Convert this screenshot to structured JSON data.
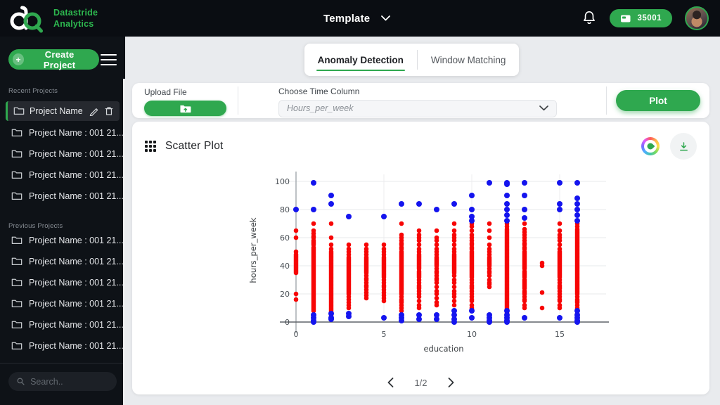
{
  "header": {
    "brand_line1": "Datastride",
    "brand_line2": "Analytics",
    "template_label": "Template",
    "credits": "35001"
  },
  "sidebar": {
    "create_project_label": "Create Project",
    "recent_label": "Recent Projects",
    "previous_label": "Previous Projects",
    "selected_project": "Project Name :...",
    "recent_projects": [
      "Project Name : 001 21...",
      "Project Name : 001 21...",
      "Project Name : 001 21...",
      "Project Name : 001 21..."
    ],
    "previous_projects": [
      "Project Name : 001 21...",
      "Project Name : 001 21...",
      "Project Name : 001 21...",
      "Project Name : 001 21...",
      "Project Name : 001 21...",
      "Project Name : 001 21...",
      "Project Name : 001 21..."
    ],
    "search_placeholder": "Search.."
  },
  "tabs": {
    "anomaly_label": "Anomaly Detection",
    "window_label": "Window Matching",
    "active": "Anomaly Detection"
  },
  "toolbar": {
    "upload_label": "Upload File",
    "time_column_label": "Choose Time Column",
    "time_column_value": "Hours_per_week",
    "plot_label": "Plot"
  },
  "card": {
    "title": "Scatter Plot"
  },
  "pagination": {
    "page": "1/2"
  },
  "colors": {
    "accent_green": "#2fa84f",
    "point_red": "#f70505",
    "point_blue": "#1414ee"
  },
  "chart_data": {
    "type": "scatter",
    "title": "Scatter Plot",
    "xlabel": "education",
    "ylabel": "hours_per_week",
    "xlim": [
      -0.9,
      17.6
    ],
    "ylim": [
      0,
      100
    ],
    "x_ticks": [
      0,
      5,
      10,
      15
    ],
    "y_ticks": [
      0,
      20,
      40,
      60,
      80,
      100
    ],
    "grid": true,
    "series": [
      {
        "name": "normal",
        "color": "#f70505",
        "marker_radius": 3.3,
        "columns": {
          "0": [
            65,
            60,
            50,
            48,
            47,
            46,
            45,
            44,
            43,
            42,
            41,
            40,
            39,
            38,
            37,
            36,
            35,
            20,
            16
          ],
          "1": [
            70,
            65,
            63,
            61,
            60,
            58,
            57,
            56,
            55,
            53,
            52,
            51,
            50,
            49,
            48,
            47,
            46,
            45,
            44,
            43,
            42,
            41,
            40,
            39,
            38,
            37,
            36,
            35,
            34,
            33,
            32,
            31,
            30,
            29,
            28,
            27,
            26,
            25,
            24,
            23,
            22,
            21,
            20,
            19,
            18,
            17,
            16,
            15,
            14,
            13,
            12,
            11,
            10,
            9,
            8
          ],
          "2": [
            70,
            60,
            55,
            52,
            50,
            49,
            48,
            47,
            46,
            45,
            44,
            43,
            42,
            41,
            40,
            39,
            38,
            37,
            36,
            35,
            34,
            33,
            32,
            31,
            30,
            29,
            28,
            27,
            26,
            25,
            24,
            23,
            22,
            21,
            20,
            19,
            18,
            17,
            16,
            15,
            14,
            13,
            12,
            11,
            10,
            9,
            8,
            7,
            6,
            5
          ],
          "3": [
            55,
            52,
            50,
            48,
            46,
            45,
            44,
            43,
            42,
            41,
            40,
            39,
            38,
            37,
            36,
            35,
            34,
            33,
            32,
            31,
            30,
            29,
            28,
            27,
            26,
            25,
            24,
            23,
            22,
            21,
            20,
            18,
            16,
            14,
            12,
            10
          ],
          "4": [
            55,
            52,
            50,
            48,
            46,
            45,
            44,
            43,
            42,
            41,
            40,
            39,
            38,
            37,
            36,
            35,
            33,
            31,
            30,
            28,
            26,
            25,
            23,
            21,
            19,
            17
          ],
          "5": [
            55,
            52,
            50,
            48,
            46,
            45,
            44,
            43,
            42,
            41,
            40,
            39,
            38,
            37,
            36,
            35,
            34,
            33,
            32,
            30,
            28,
            26,
            25,
            23,
            21,
            19,
            17,
            15
          ],
          "6": [
            70,
            62,
            60,
            58,
            56,
            55,
            53,
            52,
            50,
            49,
            48,
            47,
            46,
            45,
            44,
            43,
            42,
            41,
            40,
            39,
            38,
            37,
            36,
            35,
            34,
            33,
            32,
            31,
            30,
            29,
            28,
            27,
            26,
            25,
            24,
            23,
            22,
            21,
            20,
            18,
            16,
            15,
            14,
            12,
            10,
            8
          ],
          "7": [
            65,
            62,
            60,
            58,
            55,
            52,
            50,
            48,
            47,
            46,
            45,
            44,
            43,
            42,
            41,
            40,
            39,
            38,
            36,
            35,
            34,
            33,
            32,
            30,
            28,
            26,
            25,
            24,
            22,
            20,
            18,
            15,
            12,
            10
          ],
          "8": [
            65,
            60,
            58,
            55,
            52,
            50,
            48,
            46,
            45,
            44,
            43,
            42,
            41,
            40,
            38,
            36,
            35,
            33,
            31,
            30,
            28,
            25,
            22,
            20,
            17,
            14,
            12
          ],
          "9": [
            70,
            65,
            62,
            60,
            58,
            55,
            52,
            50,
            48,
            47,
            46,
            45,
            44,
            43,
            42,
            41,
            40,
            39,
            38,
            37,
            36,
            35,
            33,
            30,
            28,
            25,
            22,
            20,
            18,
            15,
            12
          ],
          "10": [
            70,
            68,
            65,
            62,
            60,
            58,
            56,
            55,
            53,
            52,
            50,
            49,
            48,
            47,
            46,
            45,
            44,
            43,
            42,
            41,
            40,
            39,
            38,
            37,
            36,
            35,
            34,
            33,
            32,
            30,
            28,
            26,
            25,
            24,
            22,
            20,
            18,
            16,
            15,
            12,
            10,
            8
          ],
          "11": [
            70,
            65,
            60,
            55,
            52,
            50,
            48,
            46,
            45,
            44,
            43,
            42,
            41,
            40,
            38,
            36,
            35,
            33,
            30,
            28,
            27,
            25
          ],
          "12": [
            70,
            68,
            66,
            65,
            64,
            63,
            62,
            61,
            60,
            59,
            58,
            57,
            56,
            55,
            54,
            53,
            52,
            51,
            50,
            49,
            48,
            47,
            46,
            45,
            44,
            43,
            42,
            41,
            40,
            39,
            38,
            37,
            36,
            35,
            34,
            33,
            32,
            31,
            30,
            29,
            28,
            27,
            26,
            25,
            24,
            23,
            22,
            21,
            20,
            19,
            18,
            17,
            16,
            15,
            14,
            13,
            12,
            11,
            10,
            9,
            8,
            7,
            6,
            5,
            4
          ],
          "13": [
            70,
            66,
            64,
            62,
            60,
            58,
            56,
            55,
            53,
            52,
            50,
            49,
            48,
            47,
            46,
            45,
            44,
            43,
            42,
            41,
            40,
            39,
            38,
            36,
            35,
            34,
            33,
            32,
            30,
            29,
            28,
            27,
            26,
            25,
            24,
            22,
            21,
            20,
            18,
            16,
            15,
            12,
            10
          ],
          "14": [
            42,
            40,
            21,
            10
          ],
          "15": [
            70,
            65,
            62,
            60,
            58,
            55,
            52,
            50,
            49,
            48,
            47,
            46,
            45,
            44,
            43,
            42,
            41,
            40,
            39,
            38,
            37,
            36,
            35,
            34,
            33,
            32,
            30,
            28,
            26,
            25,
            24,
            22,
            20,
            18,
            16,
            15,
            12,
            10
          ],
          "16": [
            70,
            68,
            66,
            65,
            64,
            63,
            62,
            61,
            60,
            59,
            58,
            57,
            56,
            55,
            54,
            53,
            52,
            51,
            50,
            49,
            48,
            47,
            46,
            45,
            44,
            43,
            42,
            41,
            40,
            39,
            38,
            37,
            36,
            35,
            34,
            33,
            32,
            31,
            30,
            29,
            28,
            27,
            26,
            25,
            24,
            23,
            22,
            21,
            20,
            18,
            16,
            15,
            14,
            12,
            10,
            8,
            6,
            5
          ]
        }
      },
      {
        "name": "anomaly",
        "color": "#1414ee",
        "marker_radius": 4,
        "columns": {
          "0": [
            80
          ],
          "1": [
            99,
            80,
            5,
            3,
            1,
            0
          ],
          "2": [
            90,
            84,
            6,
            3,
            2
          ],
          "3": [
            75,
            6,
            4
          ],
          "5": [
            75,
            3
          ],
          "6": [
            84,
            5,
            3,
            1
          ],
          "7": [
            84,
            5,
            2
          ],
          "8": [
            80,
            5,
            2
          ],
          "9": [
            84,
            8,
            5,
            2,
            0
          ],
          "10": [
            90,
            80,
            75,
            72,
            8,
            3
          ],
          "11": [
            99,
            5,
            3,
            1,
            0
          ],
          "12": [
            99,
            98,
            90,
            84,
            80,
            76,
            72,
            8,
            5,
            3,
            1,
            0
          ],
          "13": [
            99,
            90,
            80,
            74,
            3
          ],
          "15": [
            99,
            84,
            80,
            3
          ],
          "16": [
            99,
            88,
            84,
            80,
            76,
            72,
            8,
            5,
            3,
            1,
            0
          ]
        }
      }
    ]
  }
}
